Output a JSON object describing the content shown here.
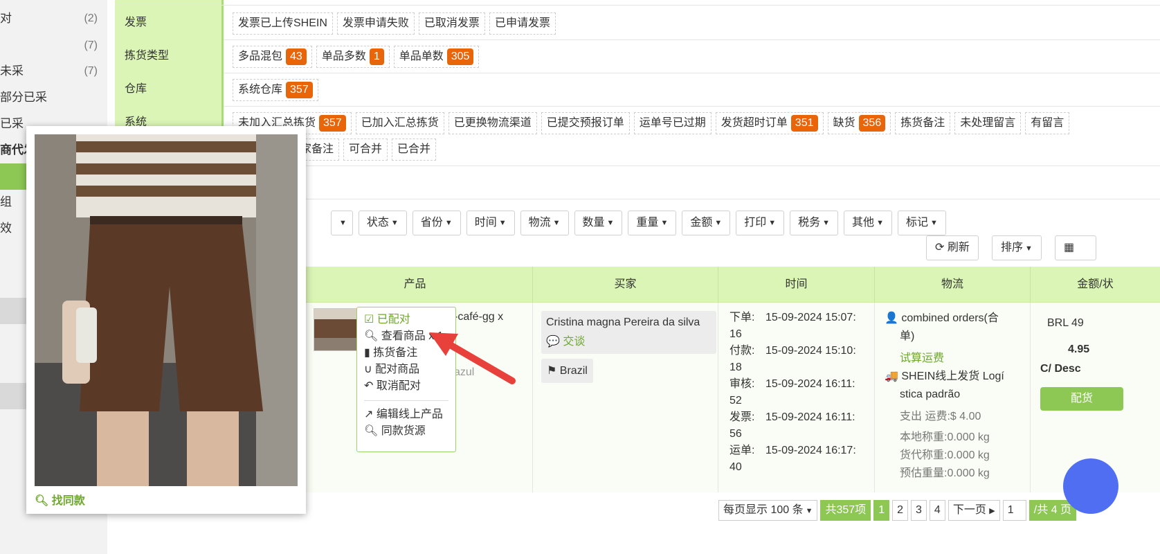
{
  "sidebar": {
    "items": [
      {
        "label": "对",
        "count": "(2)"
      },
      {
        "label": "",
        "count": "(7)"
      },
      {
        "label": "未采",
        "count": "(7)"
      },
      {
        "label": "部分已采",
        "count": ""
      },
      {
        "label": "已采",
        "count": ""
      },
      {
        "label": "商代发",
        "count": ""
      },
      {
        "label": "",
        "count": ""
      },
      {
        "label": "组",
        "count": ""
      },
      {
        "label": "效",
        "count": ""
      }
    ]
  },
  "filters": {
    "invoice": {
      "label": "发票",
      "tags": [
        {
          "text": "发票已上传SHEIN",
          "badge": ""
        },
        {
          "text": "发票申请失败",
          "badge": ""
        },
        {
          "text": "已取消发票",
          "badge": ""
        },
        {
          "text": "已申请发票",
          "badge": ""
        }
      ]
    },
    "picking": {
      "label": "拣货类型",
      "tags": [
        {
          "text": "多品混包",
          "badge": "43"
        },
        {
          "text": "单品多数",
          "badge": "1"
        },
        {
          "text": "单品单数",
          "badge": "305"
        }
      ]
    },
    "warehouse": {
      "label": "仓库",
      "tags": [
        {
          "text": "系统仓库",
          "badge": "357"
        }
      ]
    },
    "system": {
      "label": "系统",
      "tags": [
        {
          "text": "未加入汇总拣货",
          "badge": "357"
        },
        {
          "text": "已加入汇总拣货",
          "badge": ""
        },
        {
          "text": "已更换物流渠道",
          "badge": ""
        },
        {
          "text": "已提交预报订单",
          "badge": ""
        },
        {
          "text": "运单号已过期",
          "badge": ""
        },
        {
          "text": "发货超时订单",
          "badge": "351"
        },
        {
          "text": "缺货",
          "badge": "356"
        },
        {
          "text": "拣货备注",
          "badge": ""
        },
        {
          "text": "未处理留言",
          "badge": ""
        },
        {
          "text": "有留言",
          "badge": ""
        }
      ],
      "tags2": [
        {
          "text": "家备注"
        },
        {
          "text": "可合并"
        },
        {
          "text": "已合并"
        }
      ]
    }
  },
  "dropdowns": [
    "状态",
    "省份",
    "时间",
    "物流",
    "数量",
    "重量",
    "金额",
    "打印",
    "税务",
    "其他",
    "标记"
  ],
  "buttons": {
    "refresh": "刷新",
    "sort": "排序"
  },
  "table": {
    "headers": {
      "product": "产品",
      "buyer": "买家",
      "time": "时间",
      "logistics": "物流",
      "amount": "金额/状"
    },
    "row": {
      "product_name": "-café-gg x",
      "product_sub": "azul",
      "buyer_name": "Cristina magna Pereira da silva",
      "chat": "交谈",
      "country": "Brazil",
      "times": [
        {
          "k": "下单:",
          "v": "15-09-2024 15:07:",
          "v2": "16"
        },
        {
          "k": "付款:",
          "v": "15-09-2024 15:10:",
          "v2": "18"
        },
        {
          "k": "审核:",
          "v": "15-09-2024 16:11:",
          "v2": "52"
        },
        {
          "k": "发票:",
          "v": "15-09-2024 16:11:",
          "v2": "56"
        },
        {
          "k": "运单:",
          "v": "15-09-2024 16:17:",
          "v2": "40"
        }
      ],
      "logistics": {
        "l1": "combined orders(合",
        "l2": "单)",
        "trial": "试算运费",
        "l3": "SHEIN线上发货 Logí",
        "l4": "stica padrão",
        "cost": "支出 运费:$ 4.00",
        "w1": "本地称重:0.000 kg",
        "w2": "货代称重:0.000 kg",
        "w3": "预估重量:0.000 kg"
      },
      "amount": {
        "currency": "BRL 49",
        "value": "4.95",
        "desc": "C/ Desc",
        "btn": "配货"
      }
    }
  },
  "pager": {
    "per_page": "每页显示 100 条",
    "total": "共357项",
    "pages": [
      "1",
      "2",
      "3",
      "4"
    ],
    "next": "下一页",
    "input": "1",
    "of": "/共 4 页"
  },
  "popover": {
    "find_same": "找同款"
  },
  "context_menu": {
    "items": [
      "已配对",
      "查看商品 x 1",
      "拣货备注",
      "配对商品",
      "取消配对"
    ],
    "items2": [
      "编辑线上产品",
      "同款货源"
    ]
  }
}
